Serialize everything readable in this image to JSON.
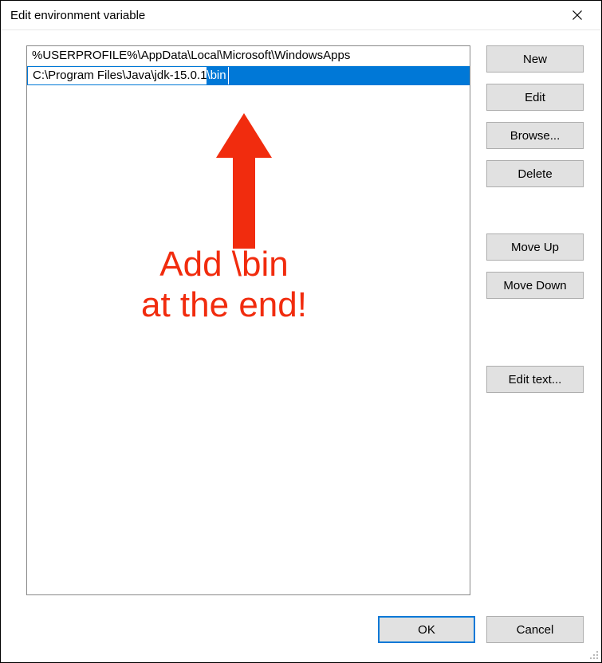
{
  "window": {
    "title": "Edit environment variable"
  },
  "list": {
    "rows": [
      "%USERPROFILE%\\AppData\\Local\\Microsoft\\WindowsApps"
    ],
    "editing": {
      "prefix": "C:\\Program Files\\Java\\jdk-15.0.1",
      "selected": "\\bin"
    }
  },
  "buttons": {
    "new": "New",
    "edit": "Edit",
    "browse": "Browse...",
    "delete": "Delete",
    "move_up": "Move Up",
    "move_down": "Move Down",
    "edit_text": "Edit text..."
  },
  "footer": {
    "ok": "OK",
    "cancel": "Cancel"
  },
  "annotation": {
    "line1": "Add \\bin",
    "line2": "at the end!"
  }
}
